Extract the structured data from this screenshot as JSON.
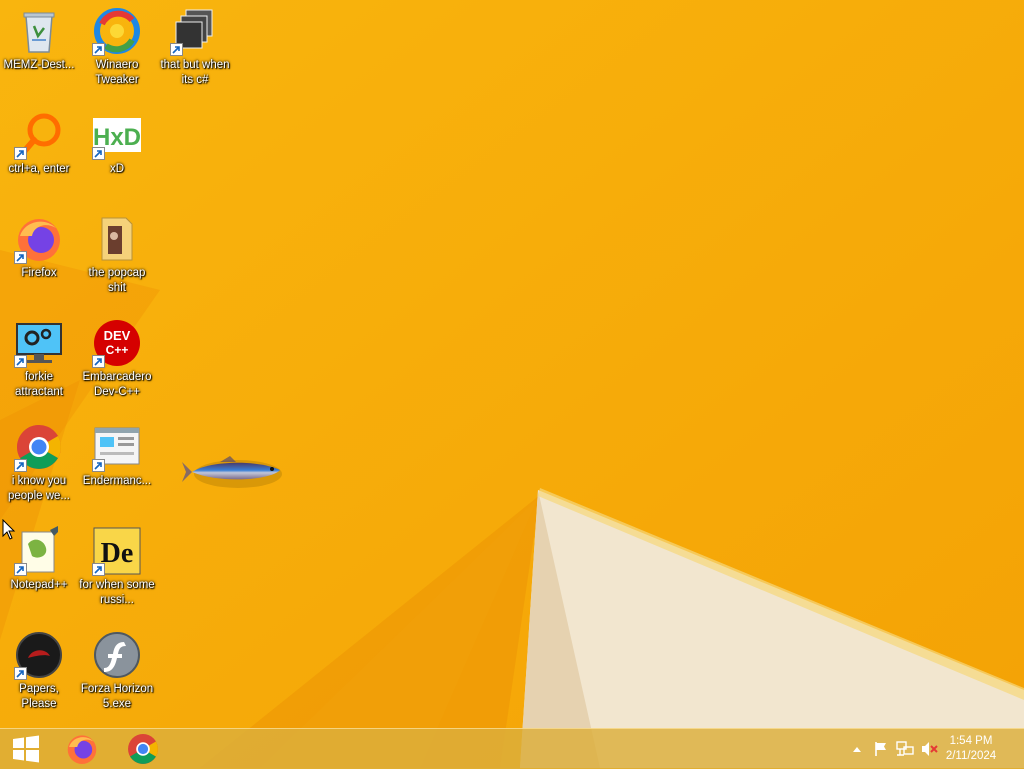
{
  "desktop": {
    "icons": [
      {
        "label": "MEMZ-Dest...",
        "icon": "recycle-bin-icon"
      },
      {
        "label": "Winaero Tweaker",
        "icon": "winaero-tweaker-icon"
      },
      {
        "label": "that but when its c#",
        "icon": "stacked-windows-icon"
      },
      {
        "label": "ctrl+a, enter",
        "icon": "magnifier-ring-icon"
      },
      {
        "label": "xD",
        "icon": "hxd-hex-editor-icon"
      },
      {
        "label": "Firefox",
        "icon": "firefox-icon"
      },
      {
        "label": "the popcap shit",
        "icon": "folder-icon"
      },
      {
        "label": "forkie attractant",
        "icon": "monitor-gears-icon"
      },
      {
        "label": "Embarcadero Dev-C++",
        "icon": "dev-cpp-icon"
      },
      {
        "label": "i know you people we...",
        "icon": "chrome-icon"
      },
      {
        "label": "Endermanc...",
        "icon": "window-document-icon"
      },
      {
        "label": "Notepad++",
        "icon": "notepad-plus-plus-icon"
      },
      {
        "label": "for when some russi...",
        "icon": "dependency-walker-icon"
      },
      {
        "label": "Papers, Please",
        "icon": "papers-please-icon"
      },
      {
        "label": "Forza Horizon 5.exe",
        "icon": "flash-player-icon"
      }
    ],
    "dev_badge": "DEV",
    "dev_badge2": "C++",
    "hxd_text": "HxD",
    "de_text": "De"
  },
  "taskbar": {
    "start": "start-button",
    "pinned": [
      "firefox-icon",
      "chrome-icon"
    ],
    "tray": [
      "show-hidden-icons-icon",
      "action-center-flag-icon",
      "network-icon",
      "volume-muted-icon"
    ],
    "clock": {
      "time": "1:54 PM",
      "date": "2/11/2024"
    }
  },
  "colors": {
    "wallpaper": "#f7ad09",
    "taskbar": "#dcaf3c"
  }
}
